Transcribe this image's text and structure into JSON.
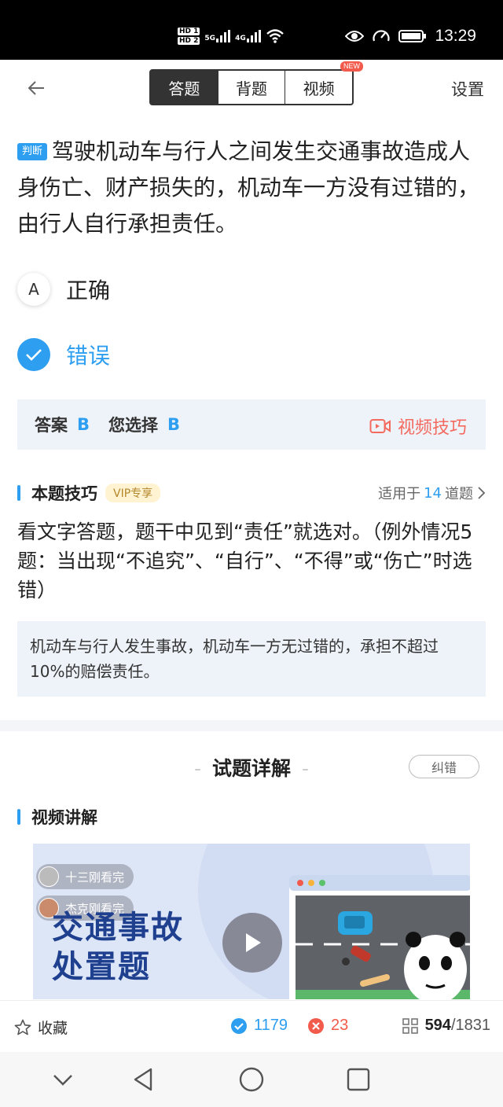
{
  "status_bar": {
    "hd1": "HD 1",
    "hd2": "HD 2",
    "net1": "5G",
    "net2": "4G",
    "time": "13:29"
  },
  "header": {
    "tabs": [
      {
        "label": "答题",
        "active": true
      },
      {
        "label": "背题",
        "active": false
      },
      {
        "label": "视频",
        "active": false,
        "badge": "NEW"
      }
    ],
    "settings_label": "设置"
  },
  "question": {
    "type_tag": "判断",
    "text": "驾驶机动车与行人之间发生交通事故造成人身伤亡、财产损失的，机动车一方没有过错的，由行人自行承担责任。",
    "options": [
      {
        "key": "A",
        "text": "正确",
        "selected": false
      },
      {
        "key": "B",
        "text": "错误",
        "selected": true
      }
    ]
  },
  "answer": {
    "answer_label": "答案",
    "answer_value": "B",
    "chosen_label": "您选择",
    "chosen_value": "B",
    "video_tip_label": "视频技巧"
  },
  "tip": {
    "title": "本题技巧",
    "vip_label": "VIP专享",
    "applies_prefix": "适用于",
    "applies_count": "14",
    "applies_suffix": "道题",
    "body": "看文字答题，题干中见到“责任”就选对。（例外情况5题：当出现“不追究”、“自行”、“不得”或“伤亡”时选错）",
    "note": "机动车与行人发生事故，机动车一方无过错的，承担不超过10%的赔偿责任。"
  },
  "detail": {
    "title": "试题详解",
    "report_label": "纠错",
    "video_section_title": "视频讲解",
    "video": {
      "watchers": [
        "十三刚看完",
        "杰克刚看完"
      ],
      "title_line1": "交通事故",
      "title_line2": "处置题"
    }
  },
  "bottom_bar": {
    "favorite_label": "收藏",
    "correct_count": "1179",
    "wrong_count": "23",
    "progress_current": "594",
    "progress_total": "/1831"
  },
  "colors": {
    "accent": "#2d9ef0",
    "error": "#f25b4b",
    "tip_red": "#f46a5f",
    "panel_bg": "#eef3f9"
  }
}
